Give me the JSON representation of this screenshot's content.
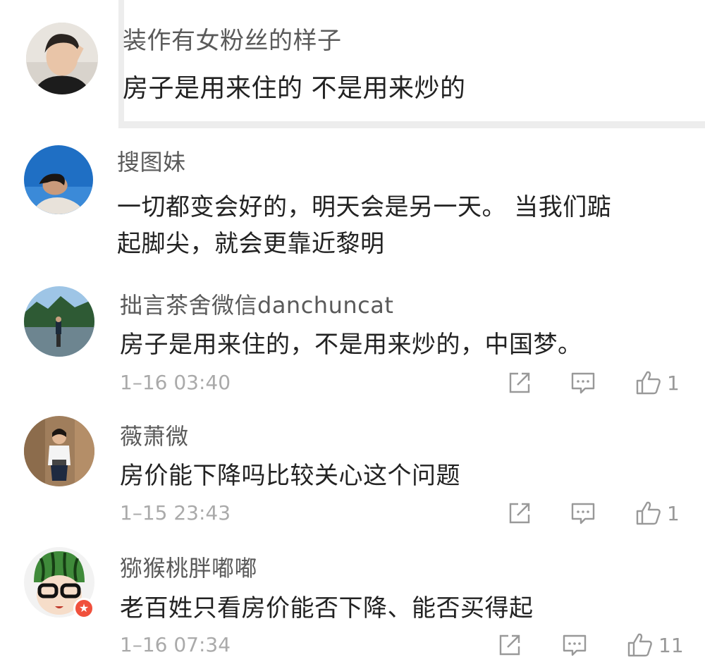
{
  "comments": [
    {
      "username": "装作有女粉丝的样子",
      "lines": [
        "房子是用来住的 不是用来炒的"
      ]
    },
    {
      "username": "搜图妹",
      "lines": [
        "一切都变会好的，明天会是另一天。 当我们踮",
        "起脚尖，就会更靠近黎明"
      ]
    },
    {
      "username": "拙言茶舍微信danchuncat",
      "lines": [
        "房子是用来住的，不是用来炒的，中国梦。"
      ],
      "time": "1–16 03:40",
      "likes": "1"
    },
    {
      "username": "薇萧微",
      "lines": [
        "房价能下降吗比较关心这个问题"
      ],
      "time": "1–15 23:43",
      "likes": "1"
    },
    {
      "username": "猕猴桃胖嘟嘟",
      "lines": [
        "老百姓只看房价能否下降、能否买得起"
      ],
      "time": "1–16 07:34",
      "likes": "11",
      "badge_icon": "star-badge-icon"
    }
  ],
  "icons": {
    "share": "share-icon",
    "reply": "comment-icon",
    "like": "thumbs-up-icon"
  },
  "colors": {
    "username": "#5a5a5a",
    "content": "#222222",
    "meta": "#aaaaaa",
    "badge": "#f0503c"
  }
}
